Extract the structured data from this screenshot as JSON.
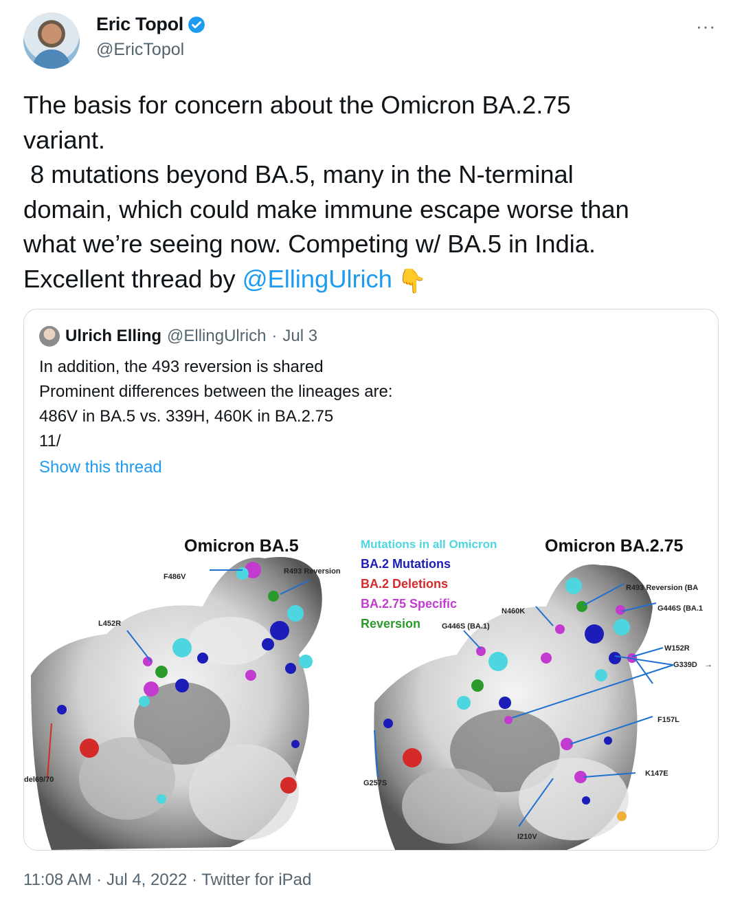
{
  "author": {
    "name": "Eric Topol",
    "handle": "@EricTopol",
    "verified_icon": "verified-badge-icon",
    "more_icon": "more-options-icon"
  },
  "tweet": {
    "text_part1": "The basis for concern about the Omicron BA.2.75\nvariant.\n 8 mutations beyond BA.5, many in the N-terminal\ndomain, which could make immune escape worse than\nwhat we’re seeing now. Competing w/ BA.5 in India.\nExcellent thread by ",
    "mention": "@EllingUlrich",
    "emoji": "👇"
  },
  "quoted_tweet": {
    "author_name": "Ulrich Elling",
    "author_handle": "@EllingUlrich",
    "separator": "·",
    "date": "Jul 3",
    "body": "In addition, the 493 reversion is shared\nProminent differences between the lineages are:\n486V in BA.5 vs. 339H, 460K in BA.2.75\n11/",
    "show_thread": "Show this thread"
  },
  "figure": {
    "left_title": "Omicron BA.5",
    "right_title": "Omicron BA.2.75",
    "legend": [
      {
        "label": "Mutations in all Omicron",
        "color": "#4dd6e0"
      },
      {
        "label": "BA.2 Mutations",
        "color": "#1c1cb8"
      },
      {
        "label": "BA.2 Deletions",
        "color": "#d42a2a"
      },
      {
        "label": "BA.2.75 Specific",
        "color": "#c23ad0"
      },
      {
        "label": "Reversion",
        "color": "#2a9a2a"
      }
    ],
    "left_labels": {
      "f486v": "F486V",
      "r493": "R493 Reversion",
      "l452r": "L452R",
      "del": "del69/70"
    },
    "right_labels": {
      "g446s_ba1": "G446S (BA.1)",
      "n460k": "N460K",
      "r493": "R493 Reversion (BA",
      "g446s": "G446S (BA.1",
      "w152r": "W152R",
      "g339d": "G339D",
      "f157l": "F157L",
      "k147e": "K147E",
      "g257s": "G257S",
      "i210v": "I210V"
    }
  },
  "footer": {
    "time": "11:08 AM",
    "sep1": "·",
    "date": "Jul 4, 2022",
    "sep2": "·",
    "source": "Twitter for iPad"
  }
}
